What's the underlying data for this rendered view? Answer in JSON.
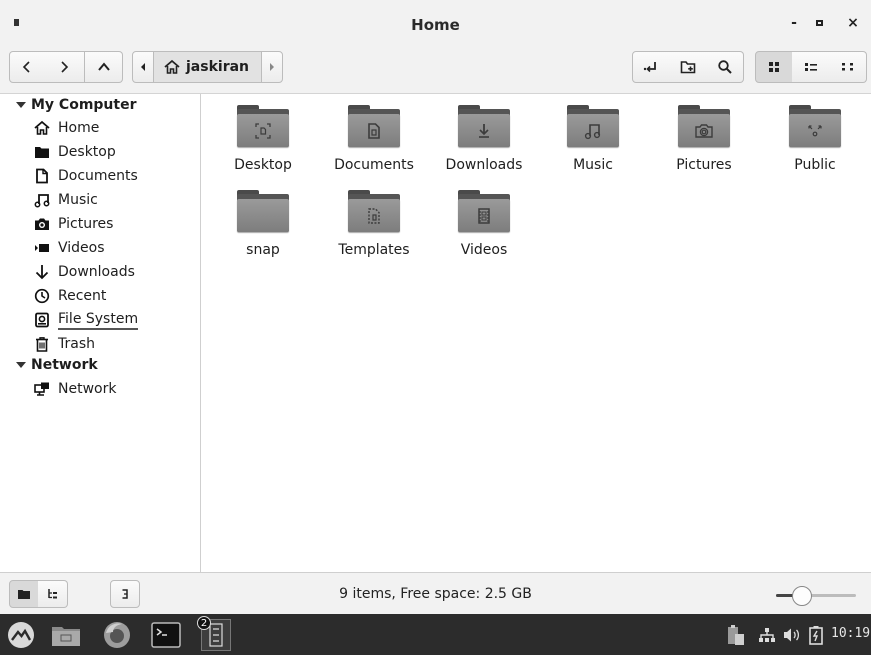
{
  "window": {
    "title": "Home"
  },
  "pathbar": {
    "current": "jaskiran"
  },
  "sidebar": {
    "sections": [
      {
        "label": "My Computer"
      },
      {
        "label": "Network"
      }
    ],
    "computer_items": [
      {
        "label": "Home",
        "icon": "home-icon"
      },
      {
        "label": "Desktop",
        "icon": "folder-icon"
      },
      {
        "label": "Documents",
        "icon": "document-icon"
      },
      {
        "label": "Music",
        "icon": "music-icon"
      },
      {
        "label": "Pictures",
        "icon": "camera-icon"
      },
      {
        "label": "Videos",
        "icon": "video-icon"
      },
      {
        "label": "Downloads",
        "icon": "download-icon"
      },
      {
        "label": "Recent",
        "icon": "clock-icon"
      },
      {
        "label": "File System",
        "icon": "drive-icon"
      },
      {
        "label": "Trash",
        "icon": "trash-icon"
      }
    ],
    "network_items": [
      {
        "label": "Network",
        "icon": "network-icon"
      }
    ]
  },
  "files": [
    {
      "name": "Desktop",
      "emblem": "desktop"
    },
    {
      "name": "Documents",
      "emblem": "document"
    },
    {
      "name": "Downloads",
      "emblem": "download"
    },
    {
      "name": "Music",
      "emblem": "music"
    },
    {
      "name": "Pictures",
      "emblem": "camera"
    },
    {
      "name": "Public",
      "emblem": "share"
    },
    {
      "name": "snap",
      "emblem": "none"
    },
    {
      "name": "Templates",
      "emblem": "template"
    },
    {
      "name": "Videos",
      "emblem": "film"
    }
  ],
  "status": {
    "text": "9 items, Free space: 2.5 GB",
    "zoom_level": 0.33
  },
  "taskbar": {
    "clock": "10:19",
    "badge_count": "2"
  }
}
